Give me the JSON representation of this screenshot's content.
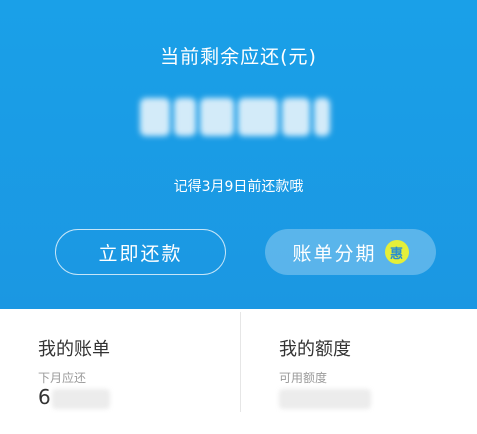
{
  "header": {
    "title": "当前剩余应还(元)",
    "due_note": "记得3月9日前还款哦"
  },
  "buttons": {
    "repay_now": "立即还款",
    "bill_installment": "账单分期",
    "installment_badge": "惠"
  },
  "cards": {
    "my_bill": {
      "title": "我的账单",
      "subtitle": "下月应还",
      "value_visible": "6"
    },
    "my_limit": {
      "title": "我的额度",
      "subtitle": "可用额度"
    }
  },
  "colors": {
    "hero_background": "#1b9be5",
    "badge": "#e4ef3a",
    "text_primary": "#333333",
    "text_secondary": "#9a9a9a"
  }
}
